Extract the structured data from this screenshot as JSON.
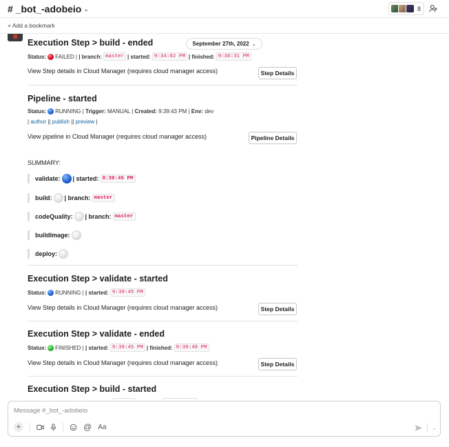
{
  "header": {
    "channel_name": "# _bot_-adobeio",
    "member_count": "8"
  },
  "bookmarks": {
    "add_label": "+ Add a bookmark"
  },
  "date_divider": "September 27th, 2022",
  "messages": {
    "build_ended": {
      "title": "Execution Step > build - ended",
      "status_label": "Status:",
      "status": "FAILED |",
      "branch_label": "| branch:",
      "branch": "master",
      "started_label": "| started:",
      "started": "9:34:02 PM",
      "finished_label": "| finished:",
      "finished": "9:36:31 PM",
      "details_text": "View Step details in Cloud Manager (requires cloud manager access)",
      "button": "Step Details"
    },
    "pipeline": {
      "title": "Pipeline - started",
      "status_label": "Status:",
      "status": "RUNNING |",
      "trigger_label": "Trigger:",
      "trigger": "MANUAL |",
      "created_label": "Created:",
      "created": "9:39:43 PM |",
      "env_label": "Env:",
      "env": "dev",
      "links_open": "|",
      "link_author": "author",
      "links_mid1": "||",
      "link_publish": "publish",
      "links_mid2": "||",
      "link_preview": "preview",
      "links_close": "|",
      "details_text": "View pipeline in Cloud Manager (requires cloud manager access)",
      "button": "Pipeline Details"
    },
    "summary": {
      "heading": "SUMMARY:",
      "rows": [
        {
          "name": "validate:",
          "sep": "| started:",
          "value": "9:39:45 PM",
          "status": "blue"
        },
        {
          "name": "build:",
          "sep": "| branch:",
          "value": "master",
          "status": "white"
        },
        {
          "name": "codeQuality:",
          "sep": "| branch:",
          "value": "master",
          "status": "white"
        },
        {
          "name": "buildImage:",
          "status": "white"
        },
        {
          "name": "deploy:",
          "status": "white"
        }
      ]
    },
    "validate_started": {
      "title": "Execution Step > validate - started",
      "status_label": "Status:",
      "status": "RUNNING |",
      "started_label": "| started:",
      "started": "9:39:45 PM",
      "details_text": "View Step details in Cloud Manager (requires cloud manager access)",
      "button": "Step Details"
    },
    "validate_ended": {
      "title": "Execution Step > validate - ended",
      "status_label": "Status:",
      "status": "FINISHED |",
      "started_label": "| started:",
      "started": "9:39:45 PM",
      "finished_label": "| finished:",
      "finished": "9:39:48 PM",
      "details_text": "View Step details in Cloud Manager (requires cloud manager access)",
      "button": "Step Details"
    },
    "build_started": {
      "title": "Execution Step > build - started"
    }
  },
  "composer": {
    "placeholder": "Message #_bot_-adobeio",
    "format_label": "Aa"
  }
}
